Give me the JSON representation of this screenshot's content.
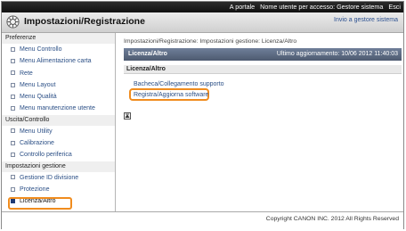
{
  "topbar": {
    "portal_link": "A portale",
    "user_label": "Nome utente per accesso: Gestore sistema",
    "logout": "Esci"
  },
  "header": {
    "title": "Impostazioni/Registrazione",
    "send_link": "Invio a gestore sistema",
    "icon": "settings-icon"
  },
  "sidebar": {
    "sections": [
      {
        "title": "Preferenze",
        "items": [
          {
            "label": "Menu Controllo"
          },
          {
            "label": "Menu Alimentazione carta"
          },
          {
            "label": "Rete"
          },
          {
            "label": "Menu Layout"
          },
          {
            "label": "Menu Qualità"
          },
          {
            "label": "Menu manutenzione utente"
          }
        ]
      },
      {
        "title": "Uscita/Controllo",
        "items": [
          {
            "label": "Menu Utility"
          },
          {
            "label": "Calibrazione"
          },
          {
            "label": "Controllo periferica"
          }
        ]
      },
      {
        "title": "Impostazioni gestione",
        "items": [
          {
            "label": "Gestione ID divisione"
          },
          {
            "label": "Protezione"
          },
          {
            "label": "Licenza/Altro",
            "active": true
          }
        ]
      }
    ]
  },
  "main": {
    "breadcrumb": "Impostazioni/Registrazione: Impostazioni gestione: Licenza/Altro",
    "infobar": {
      "left": "Licenza/Altro",
      "right": "Ultimo aggiornamento: 10/06 2012 11:40:03"
    },
    "section_title": "Licenza/Altro",
    "links": [
      "Bacheca/Collegamento supporto",
      "Registra/Aggiorna software"
    ],
    "top_icon": "back-to-top-icon"
  },
  "footer": {
    "copyright": "Copyright CANON INC. 2012 All Rights Reserved"
  },
  "colors": {
    "highlight": "#f08c1e",
    "link": "#2b4f86",
    "infobar": "#5a6880"
  }
}
